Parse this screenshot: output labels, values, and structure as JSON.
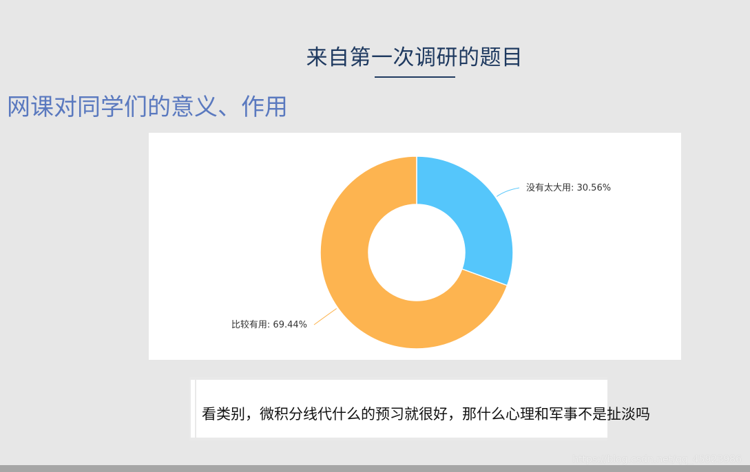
{
  "slide": {
    "title": "来自第一次调研的题目",
    "heading": "网课对同学们的意义、作用"
  },
  "chart_data": {
    "type": "pie",
    "donut": true,
    "slices": [
      {
        "label": "没有太大用: 30.56%",
        "name": "没有太大用",
        "value": 30.56,
        "color": "#55c6fb"
      },
      {
        "label": "比较有用: 69.44%",
        "name": "比较有用",
        "value": 69.44,
        "color": "#fdb450"
      }
    ]
  },
  "comment": {
    "text": "看类别，微积分线代什么的预习就很好，那什么心理和军事不是扯淡吗"
  },
  "watermark": "https://blog.csdn.net/qq_45923986",
  "colors": {
    "background": "#e7e7e7",
    "title": "#1f3a60",
    "heading": "#5a79bf"
  }
}
